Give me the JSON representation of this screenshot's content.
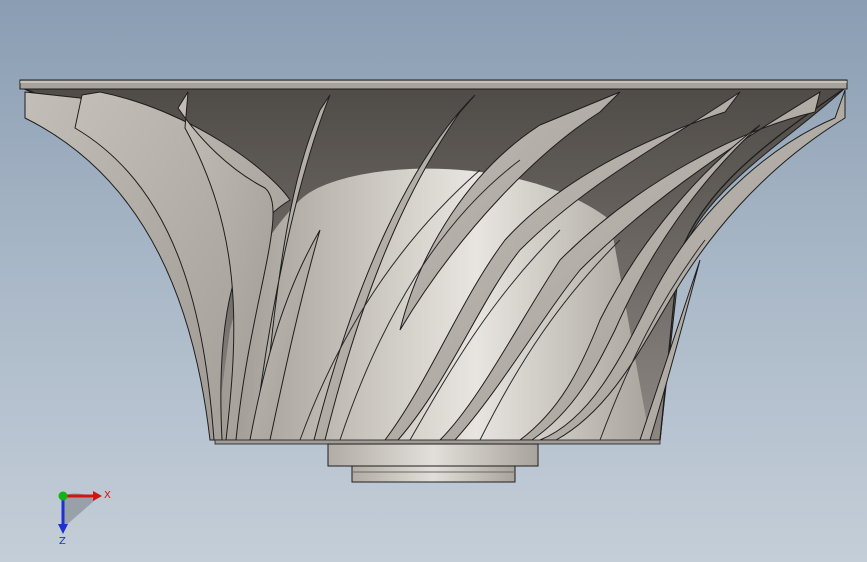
{
  "viewport": {
    "background_top": "#8a9db2",
    "background_bottom": "#c4ced8"
  },
  "model": {
    "part": "impeller",
    "face_color": "#b9b4ad",
    "shadow_color": "#5f5b57",
    "edge_color": "#1e1e1e",
    "blade_count": 12
  },
  "triad": {
    "x_label": "X",
    "z_label": "Z",
    "x_color": "#d11414",
    "y_color": "#12b312",
    "z_color": "#1f2fd0"
  }
}
